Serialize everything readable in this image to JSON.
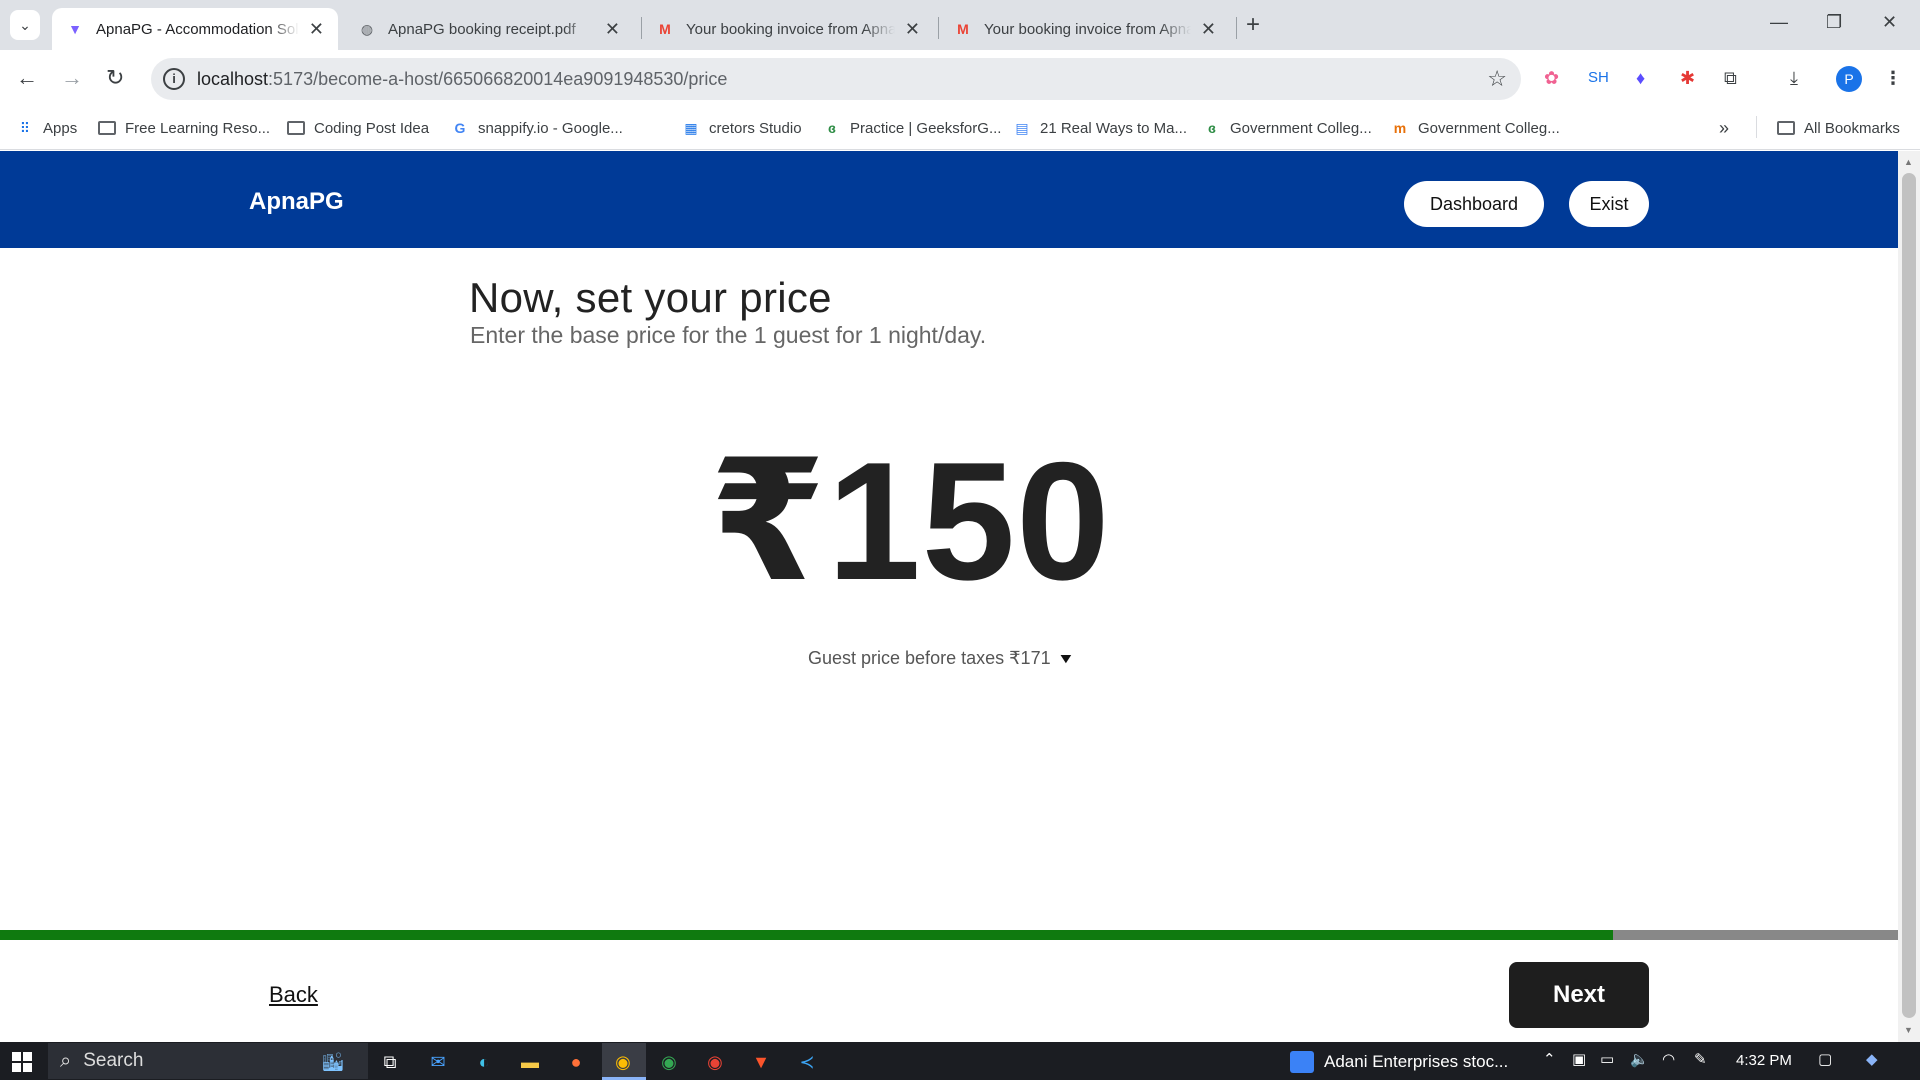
{
  "browser": {
    "tabs": [
      {
        "title": "ApnaPG - Accommodation Solution",
        "icon": "apnapg-favicon",
        "active": true
      },
      {
        "title": "ApnaPG booking receipt.pdf",
        "icon": "globe-icon",
        "active": false
      },
      {
        "title": "Your booking invoice from ApnaPG",
        "icon": "gmail-icon",
        "active": false
      },
      {
        "title": "Your booking invoice from ApnaPG",
        "icon": "gmail-icon",
        "active": false
      }
    ],
    "url_host": "localhost",
    "url_path": ":5173/become-a-host/665066820014ea9091948530/price",
    "profile_initial": "P",
    "extension_sh": "SH",
    "bookmarks": [
      {
        "label": "Apps",
        "icon": "apps-grid-icon"
      },
      {
        "label": "Free Learning Reso...",
        "icon": "folder-icon"
      },
      {
        "label": "Coding Post Idea",
        "icon": "folder-icon"
      },
      {
        "label": "snappify.io - Google...",
        "icon": "google-icon"
      },
      {
        "label": "cretors Studio",
        "icon": "studio-icon"
      },
      {
        "label": "Practice | GeeksforG...",
        "icon": "gfg-icon"
      },
      {
        "label": "21 Real Ways to Ma...",
        "icon": "docs-icon"
      },
      {
        "label": "Government Colleg...",
        "icon": "gfg-icon"
      },
      {
        "label": "Government Colleg...",
        "icon": "college-icon"
      }
    ],
    "all_bookmarks": "All Bookmarks"
  },
  "header": {
    "brand": "ApnaPG",
    "dashboard_label": "Dashboard",
    "exit_label": "Exist"
  },
  "main": {
    "title": "Now, set your price",
    "subtitle": "Enter the base price for the 1 guest for 1 night/day.",
    "price_display": "₹150",
    "guest_price_text": "Guest price before taxes ₹171"
  },
  "progress": {
    "fraction": 0.85
  },
  "footer": {
    "back_label": "Back",
    "next_label": "Next"
  },
  "taskbar": {
    "search_placeholder": "Search",
    "news_text": "Adani Enterprises stoc...",
    "time": "4:32 PM"
  },
  "colors": {
    "header_bg": "#003a97",
    "progress_fill": "#0f7a0f",
    "progress_track": "#888888",
    "next_bg": "#1e1e1e"
  }
}
